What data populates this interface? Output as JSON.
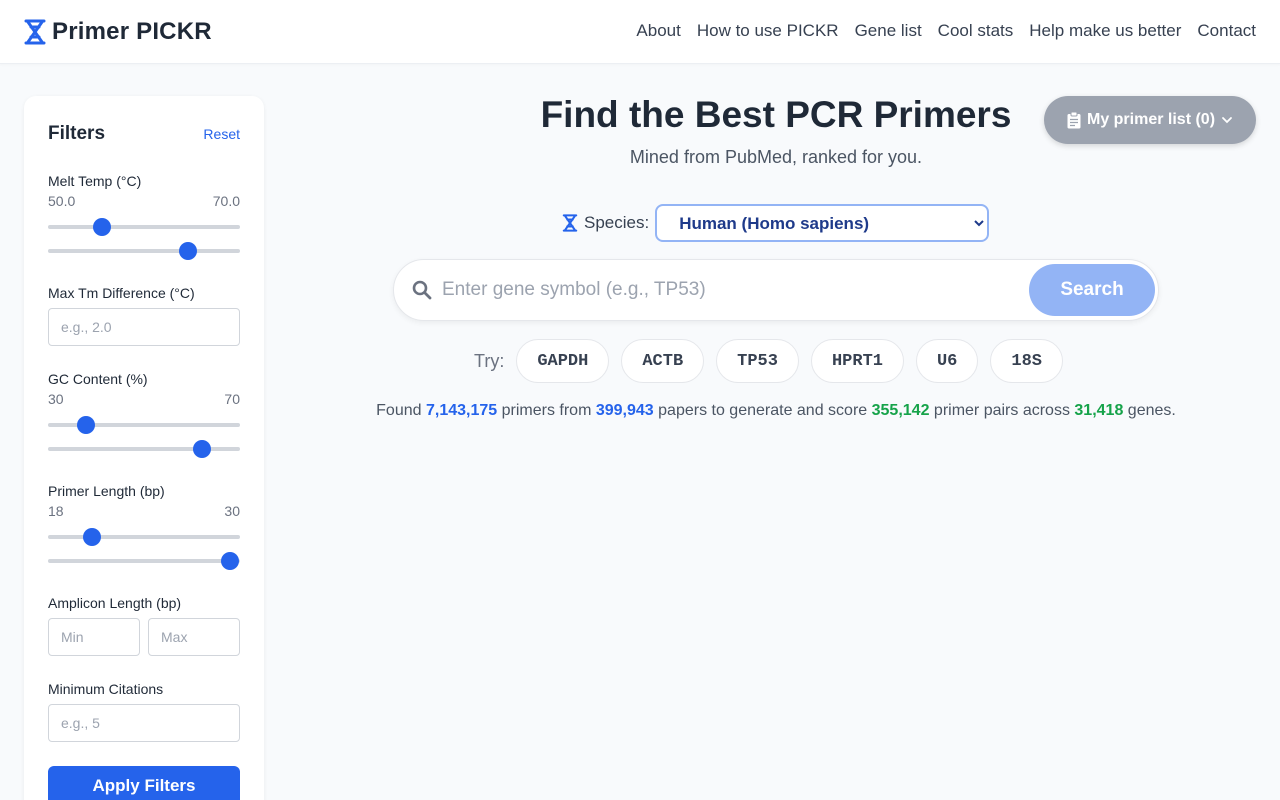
{
  "header": {
    "logo_text": "Primer PICKR",
    "nav": [
      "About",
      "How to use PICKR",
      "Gene list",
      "Cool stats",
      "Help make us better",
      "Contact"
    ]
  },
  "sidebar": {
    "title": "Filters",
    "reset_label": "Reset",
    "melt_temp": {
      "label": "Melt Temp (°C)",
      "min_label": "50.0",
      "max_label": "70.0",
      "low_fraction": 0.28,
      "high_fraction": 0.73
    },
    "max_tm_diff": {
      "label": "Max Tm Difference (°C)",
      "placeholder": "e.g., 2.0"
    },
    "gc_content": {
      "label": "GC Content (%)",
      "min_label": "30",
      "max_label": "70",
      "low_fraction": 0.2,
      "high_fraction": 0.8
    },
    "primer_length": {
      "label": "Primer Length (bp)",
      "min_label": "18",
      "max_label": "30",
      "low_fraction": 0.23,
      "high_fraction": 0.95
    },
    "amplicon_length": {
      "label": "Amplicon Length (bp)",
      "min_placeholder": "Min",
      "max_placeholder": "Max"
    },
    "min_citations": {
      "label": "Minimum Citations",
      "placeholder": "e.g., 5"
    },
    "apply_label": "Apply Filters"
  },
  "main": {
    "title": "Find the Best PCR Primers",
    "subtitle": "Mined from PubMed, ranked for you.",
    "primer_list_label": "My primer list (0)",
    "species_label": "Species:",
    "species_selected": "Human (Homo sapiens)",
    "search_placeholder": "Enter gene symbol (e.g., TP53)",
    "search_button": "Search",
    "try_label": "Try:",
    "try_genes": [
      "GAPDH",
      "ACTB",
      "TP53",
      "HPRT1",
      "U6",
      "18S"
    ],
    "stats": {
      "t1": "Found",
      "primers": "7,143,175",
      "t2": "primers from",
      "papers": "399,943",
      "t3": "papers to generate and score",
      "pairs": "355,142",
      "t4": "primer pairs across",
      "genes": "31,418",
      "t5": "genes."
    }
  },
  "colors": {
    "accent": "#2563eb",
    "accent_light": "#93b4f5",
    "green": "#16a34a",
    "button_gray": "#9ca3af"
  },
  "icons": {
    "logo": "dna-hourglass-icon",
    "species": "dna-hourglass-icon",
    "search": "search-icon",
    "primer_list": "clipboard-icon",
    "dropdown": "chevron-down-icon"
  }
}
